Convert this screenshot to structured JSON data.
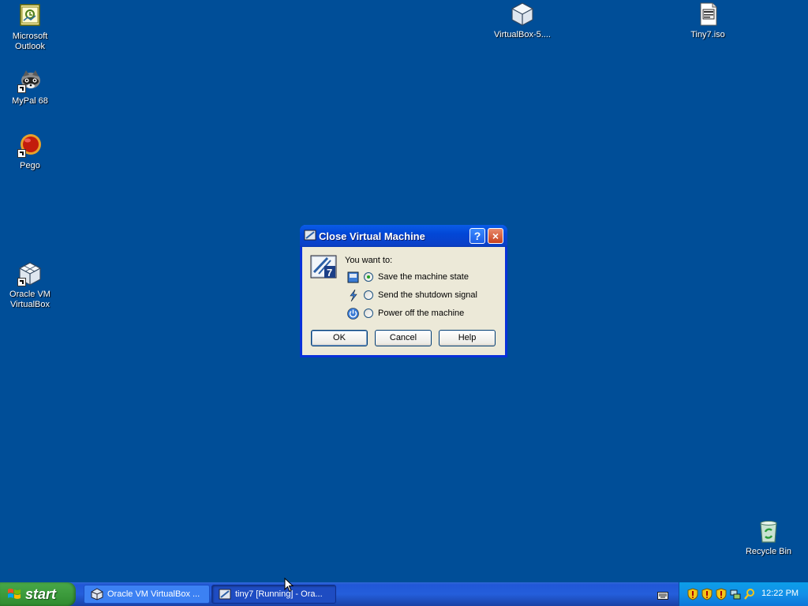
{
  "desktop": {
    "icons": [
      {
        "label": "Microsoft\nOutlook",
        "icon": "outlook-icon"
      },
      {
        "label": "MyPal 68",
        "icon": "mypal-icon"
      },
      {
        "label": "Pego",
        "icon": "pego-icon"
      },
      {
        "label": "Oracle VM\nVirtualBox",
        "icon": "virtualbox-icon"
      },
      {
        "label": "VirtualBox-5....",
        "icon": "virtualbox-installer-icon"
      },
      {
        "label": "Tiny7.iso",
        "icon": "iso-file-icon"
      },
      {
        "label": "Recycle Bin",
        "icon": "recycle-bin-icon"
      }
    ]
  },
  "dialog": {
    "title": "Close Virtual Machine",
    "help_button": "?",
    "close_button": "×",
    "prompt": "You want to:",
    "options": [
      {
        "label": "Save the machine state",
        "checked": true,
        "icon": "save-state-icon"
      },
      {
        "label": "Send the shutdown signal",
        "checked": false,
        "icon": "shutdown-signal-icon"
      },
      {
        "label": "Power off the machine",
        "checked": false,
        "icon": "power-off-icon"
      }
    ],
    "buttons": {
      "ok": "OK",
      "cancel": "Cancel",
      "help": "Help"
    }
  },
  "taskbar": {
    "start_label": "start",
    "tasks": [
      {
        "label": "Oracle VM VirtualBox ...",
        "active": false
      },
      {
        "label": "tiny7 [Running] - Ora...",
        "active": true
      }
    ],
    "clock": "12:22 PM"
  },
  "colors": {
    "desktop_bg": "#004e98",
    "titlebar": "#0a40c8",
    "dialog_bg": "#ece9d8",
    "start_green": "#3c9b3c"
  }
}
